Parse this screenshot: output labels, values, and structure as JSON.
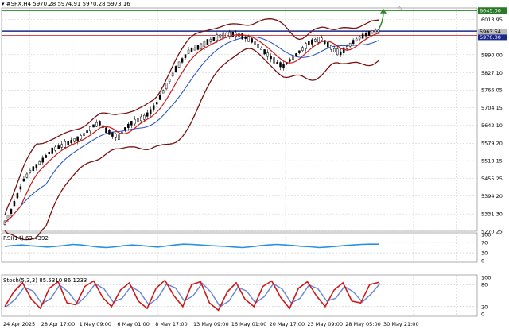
{
  "header": {
    "symbol": "#SPX,H4",
    "ohlc": "5970.28 5974.91 5970.28 5973.16"
  },
  "main_axis": {
    "ticks": [
      "6045.00",
      "6013.95",
      "5951.05",
      "5890.00",
      "5827.10",
      "5766.05",
      "5704.15",
      "5642.10",
      "5579.20",
      "5518.15",
      "5455.25",
      "5394.20",
      "5331.30",
      "5270.25"
    ],
    "tick_values": [
      6045.0,
      6013.95,
      5951.05,
      5890.0,
      5827.1,
      5766.05,
      5704.15,
      5642.1,
      5579.2,
      5518.15,
      5455.25,
      5394.2,
      5331.3,
      5270.25
    ],
    "ylim": [
      5270.25,
      6054.0
    ]
  },
  "price_labels": {
    "resistance": "6045.00",
    "bid_line": "5963.54",
    "current": "5970.00"
  },
  "rsi": {
    "label": "RSI(14) 63.4392",
    "ticks": [
      "100",
      "70",
      "30",
      "0"
    ]
  },
  "stoch": {
    "label": "Stoch(5,3,3) 85.5310 86.1233",
    "ticks": [
      "100",
      "80",
      "20",
      "0"
    ]
  },
  "time_axis": [
    "24 Apr 2025",
    "28 Apr 17:00",
    "1 May 09:00",
    "6 May 01:00",
    "8 May 17:00",
    "13 May 09:00",
    "16 May 01:00",
    "20 May 17:00",
    "23 May 09:00",
    "28 May 05:00",
    "30 May 21:00"
  ],
  "colors": {
    "candle": "#000000",
    "bollinger": "#7a1010",
    "ma_fast": "#d01818",
    "ma_slow": "#2a55c8",
    "rsi": "#2890e0",
    "stoch_main": "#d01818",
    "stoch_signal": "#6a8ad8",
    "resistance": "#2a8a2a",
    "current_line": "#1a2a8a",
    "bid_line": "#cc3333",
    "arrow": "#2a8a2a"
  },
  "chart_data": {
    "type": "line",
    "title": "#SPX,H4",
    "series": [
      {
        "name": "#SPX,H4",
        "values": [
          5300,
          5340,
          5395,
          5450,
          5480,
          5500,
          5520,
          5545,
          5560,
          5570,
          5580,
          5590,
          5600,
          5620,
          5640,
          5650,
          5625,
          5610,
          5600,
          5630,
          5650,
          5660,
          5670,
          5690,
          5720,
          5760,
          5800,
          5840,
          5870,
          5900,
          5910,
          5920,
          5935,
          5945,
          5955,
          5960,
          5962,
          5960,
          5950,
          5940,
          5920,
          5900,
          5880,
          5860,
          5850,
          5870,
          5890,
          5910,
          5930,
          5940,
          5945,
          5925,
          5905,
          5895,
          5915,
          5935,
          5950,
          5960,
          5970,
          5973
        ]
      },
      {
        "name": "RSI(14)",
        "values": [
          55,
          58,
          60,
          57,
          55,
          52,
          55,
          58,
          62,
          60,
          56,
          52,
          50,
          53,
          57,
          60,
          58,
          55,
          52,
          56,
          60,
          63,
          62,
          60,
          58,
          56,
          55,
          52,
          50,
          53,
          57,
          60,
          62,
          60,
          58,
          55,
          53,
          50,
          52,
          55,
          58,
          60,
          62,
          63,
          63
        ]
      },
      {
        "name": "Stoch(5,3,3)",
        "values": [
          20,
          60,
          85,
          40,
          15,
          70,
          88,
          30,
          25,
          75,
          90,
          45,
          20,
          65,
          85,
          35,
          15,
          70,
          92,
          50,
          20,
          80,
          88,
          30,
          10,
          60,
          85,
          40,
          20,
          75,
          90,
          45,
          15,
          70,
          88,
          50,
          20,
          65,
          85,
          35,
          30,
          80,
          86
        ]
      }
    ],
    "horizontal_lines": [
      {
        "value": 6045.0,
        "label": "6045.00"
      },
      {
        "value": 5970.0,
        "label": "5970.00"
      },
      {
        "value": 5963.54,
        "label": "5963.54"
      }
    ]
  }
}
